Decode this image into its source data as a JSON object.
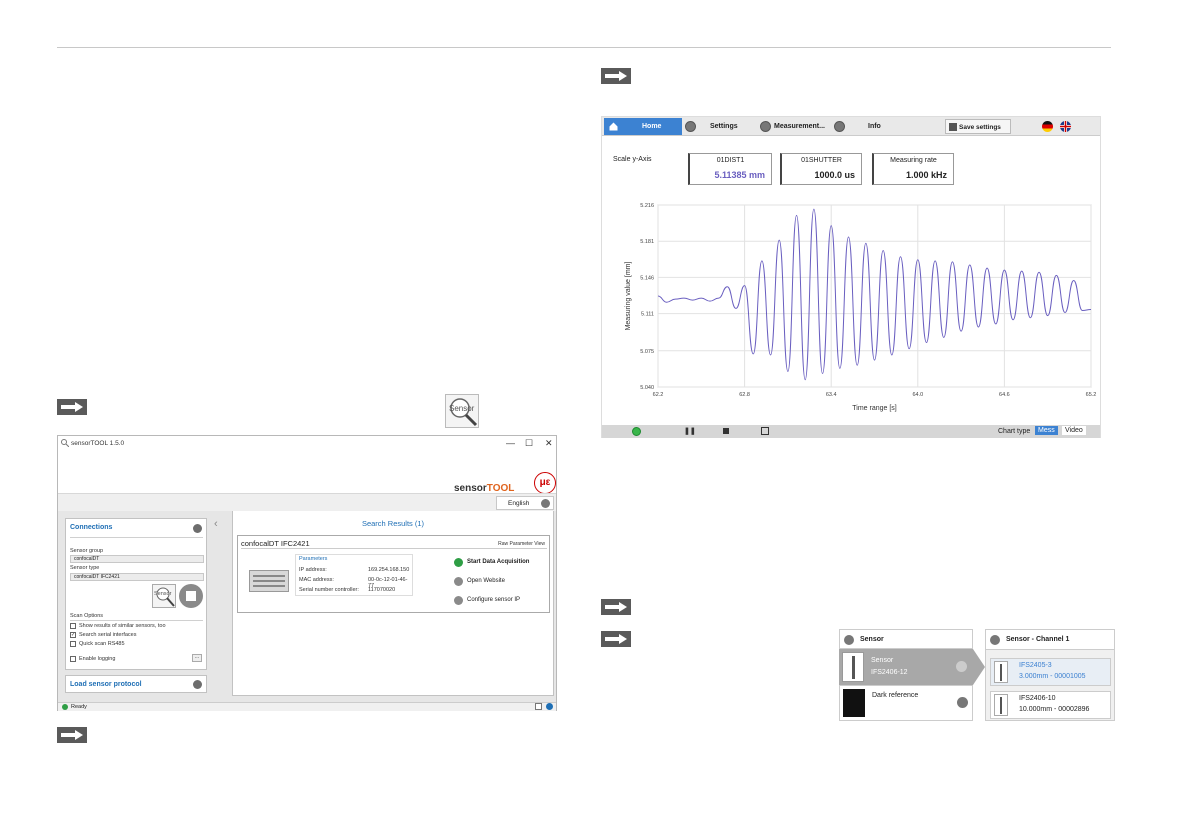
{
  "sensortool": {
    "title": "sensorTOOL 1.5.0",
    "window_controls": [
      "—",
      "☐",
      "✕"
    ],
    "brand_prefix": "sensor",
    "brand_suffix": "TOOL",
    "logo_text": "με",
    "language": "English",
    "connections_title": "Connections",
    "sensor_group_label": "Sensor group",
    "sensor_group_value": "confocalDT",
    "sensor_type_label": "Sensor type",
    "sensor_type_value": "confocalDT IFC2421",
    "sensor_button_label": "Sensor",
    "scan_options_label": "Scan Options",
    "options": [
      {
        "label": "Show results of similar sensors, too",
        "checked": false
      },
      {
        "label": "Search serial interfaces",
        "checked": true
      },
      {
        "label": "Quick scan RS485",
        "checked": false
      }
    ],
    "enable_logging": "Enable logging",
    "load_protocol": "Load sensor protocol",
    "results_title": "Search Results (1)",
    "device_name": "confocalDT IFC2421",
    "raw_view": "Raw Parameter View",
    "parameters_title": "Parameters",
    "params": [
      {
        "k": "IP address:",
        "v": "169.254.168.150"
      },
      {
        "k": "MAC address:",
        "v": "00-0c-12-01-46-77"
      },
      {
        "k": "Serial number controller:",
        "v": "117070020"
      }
    ],
    "actions": [
      "Start Data Acquisition",
      "Open Website",
      "Configure sensor IP"
    ],
    "status": "Ready"
  },
  "web": {
    "nav": {
      "home": "Home",
      "settings": "Settings",
      "measurement": "Measurement...",
      "info": "Info",
      "save": "Save settings"
    },
    "scale_label": "Scale y-Axis",
    "values": [
      {
        "label": "01DIST1",
        "value": "5.11385 mm",
        "color": "#6a5fc0"
      },
      {
        "label": "01SHUTTER",
        "value": "1000.0 us",
        "color": "#222222"
      },
      {
        "label": "Measuring rate",
        "value": "1.000 kHz",
        "color": "#222222"
      }
    ],
    "chart_type_label": "Chart type",
    "chart_type_mess": "Mess",
    "chart_type_video": "Video"
  },
  "chart_data": {
    "type": "line",
    "xlabel": "Time range [s]",
    "ylabel": "Measuring value [mm]",
    "xlim": [
      62.2,
      65.2
    ],
    "ylim": [
      5.04,
      5.216
    ],
    "xticks": [
      "62.2",
      "62.8",
      "63.4",
      "64.0",
      "64.6",
      "65.2"
    ],
    "yticks": [
      "5.216",
      "5.181",
      "5.146",
      "5.111",
      "5.075",
      "5.040"
    ],
    "grid": true,
    "series_color": "#6a5fc0",
    "series": [
      {
        "x": [
          62.2,
          62.26,
          62.32,
          62.38,
          62.44,
          62.5,
          62.56,
          62.62,
          62.68,
          62.74,
          62.8,
          62.86,
          62.92,
          62.98,
          63.04,
          63.1,
          63.16,
          63.22,
          63.28,
          63.34,
          63.4,
          63.46,
          63.52,
          63.58,
          63.64,
          63.7,
          63.76,
          63.82,
          63.88,
          63.94,
          64.0,
          64.06,
          64.12,
          64.18,
          64.24,
          64.3,
          64.36,
          64.42,
          64.48,
          64.54,
          64.6,
          64.66,
          64.72,
          64.78,
          64.84,
          64.9,
          64.96,
          65.02,
          65.08,
          65.14,
          65.2
        ],
        "y": [
          5.128,
          5.122,
          5.125,
          5.126,
          5.124,
          5.126,
          5.123,
          5.126,
          5.137,
          5.116,
          5.138,
          5.072,
          5.162,
          5.071,
          5.182,
          5.055,
          5.206,
          5.047,
          5.212,
          5.053,
          5.196,
          5.058,
          5.185,
          5.061,
          5.179,
          5.066,
          5.172,
          5.071,
          5.166,
          5.077,
          5.163,
          5.083,
          5.162,
          5.088,
          5.161,
          5.094,
          5.158,
          5.098,
          5.155,
          5.101,
          5.153,
          5.105,
          5.152,
          5.107,
          5.151,
          5.109,
          5.148,
          5.112,
          5.143,
          5.114,
          5.115
        ]
      }
    ]
  },
  "sensor_panel": {
    "left_title": "Sensor",
    "right_title": "Sensor - Channel 1",
    "left_items": [
      {
        "title": "Sensor",
        "subtitle": "IFS2406-12"
      },
      {
        "title": "Dark reference",
        "subtitle": ""
      }
    ],
    "right_items": [
      {
        "title": "IFS2405-3",
        "subtitle": "3.000mm - 00001005"
      },
      {
        "title": "IFS2406-10",
        "subtitle": "10.000mm - 00002896"
      }
    ]
  }
}
